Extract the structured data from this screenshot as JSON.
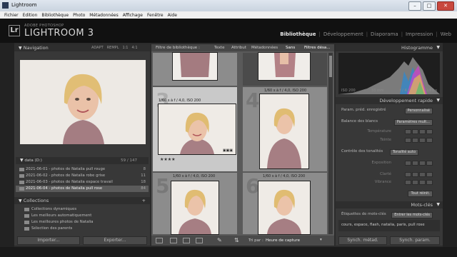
{
  "window": {
    "title": "Lightroom"
  },
  "menu": [
    "Fichier",
    "Edition",
    "Bibliothèque",
    "Photo",
    "Métadonnées",
    "Affichage",
    "Fenêtre",
    "Aide"
  ],
  "brand": {
    "small": "ADOBE PHOTOSHOP",
    "big": "LIGHTROOM 3",
    "logo": "Lr"
  },
  "modules": [
    {
      "label": "Bibliothèque",
      "active": true
    },
    {
      "label": "Développement",
      "active": false
    },
    {
      "label": "Diaporama",
      "active": false
    },
    {
      "label": "Impression",
      "active": false
    },
    {
      "label": "Web",
      "active": false
    }
  ],
  "navigator": {
    "title": "Navigation",
    "opts": [
      "ADAPT",
      "REMPL",
      "1:1",
      "4:1"
    ]
  },
  "folders": {
    "title": "data (D:)",
    "stats": "59 / 147",
    "rows": [
      {
        "label": "2021-06-01 - photos de Natalia pull rouge",
        "count": "8"
      },
      {
        "label": "2021-06-02 - photos de Natalia robe grise",
        "count": "11"
      },
      {
        "label": "2021-06-03 - photos de Natalia espace travail",
        "count": "18"
      },
      {
        "label": "2021-06-04 - photos de Natalia pull rose",
        "count": "84"
      }
    ]
  },
  "collections": {
    "title": "Collections",
    "rows": [
      "Collections dynamiques",
      "Les meilleurs automatiquement",
      "Les meilleures photos de Natalia",
      "Sélection des parents"
    ]
  },
  "left_buttons": {
    "import": "Importer...",
    "export": "Exporter..."
  },
  "filterbar": {
    "label": "Filtre de bibliothèque :",
    "opts": [
      "Texte",
      "Attribut",
      "Métadonnées",
      "Sans"
    ],
    "preset": "Filtres désa..."
  },
  "grid": {
    "cells": [
      {
        "num": "",
        "info": ""
      },
      {
        "num": "",
        "info": ""
      },
      {
        "num": "3",
        "info": "1/60 s à f / 4,0, ISO 200",
        "badge": "5",
        "stars": "★★★★"
      },
      {
        "num": "4",
        "info": "1/60 s à f / 4,0, ISO 200"
      },
      {
        "num": "5",
        "info": "1/60 s à f / 4,0, ISO 200"
      },
      {
        "num": "6",
        "info": "1/60 s à f / 4,0, ISO 200"
      }
    ]
  },
  "toolbar": {
    "sort_label": "Tri par :",
    "sort_value": "Heure de capture"
  },
  "histogram": {
    "title": "Histogramme",
    "labels": [
      "ISO 200",
      "33 mm",
      "f / 4,0",
      "1/60 s"
    ]
  },
  "quick_develop": {
    "title": "Développement rapide",
    "preset_label": "Param. préd. enregistré",
    "preset_value": "Personnalisé",
    "wb_label": "Balance des blancs",
    "wb_value": "Paramètres mult...",
    "temp_label": "Température",
    "tint_label": "Teinte",
    "tone_label": "Contrôle des tonalités",
    "auto_tone": "Tonalité auto",
    "exposure_label": "Exposition",
    "clarity_label": "Clarté",
    "vibrance_label": "Vibrance",
    "reset": "Tout réinit."
  },
  "keywords": {
    "title": "Mots-clés",
    "tags_label": "Étiquettes de mots-clés",
    "tags_value": "Entrer les mots-clés",
    "list": "cours, espace, flash, natalia, paris, pull rose"
  },
  "right_buttons": {
    "sync_meta": "Synch. métad.",
    "sync_param": "Synch. param."
  },
  "colors": {
    "header_bg": "#111111",
    "panel_bg": "#383838",
    "center_bg": "#5a5a5a",
    "active_module": "#e8e8e8"
  }
}
